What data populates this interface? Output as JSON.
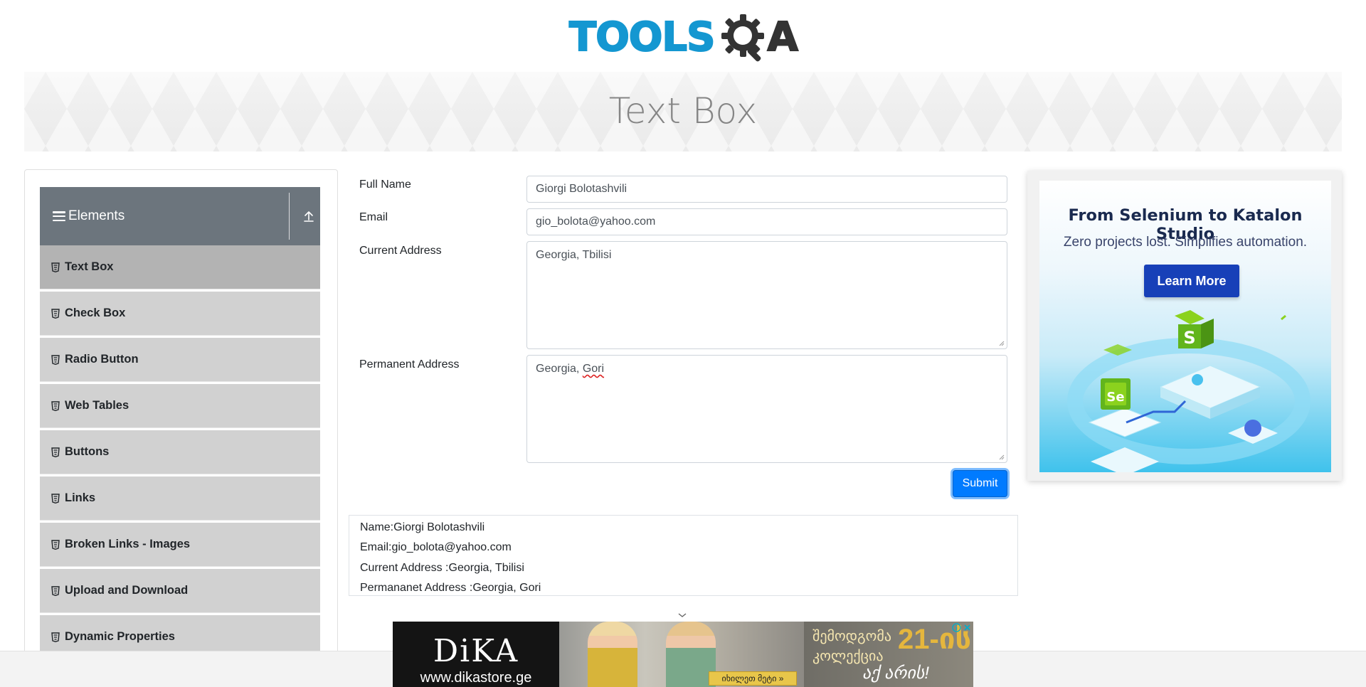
{
  "logo": {
    "text_left": "TOOLS",
    "text_right": "A"
  },
  "banner": {
    "title": "Text Box"
  },
  "sidebar": {
    "group_title": "Elements",
    "items": [
      {
        "label": "Text Box",
        "active": true
      },
      {
        "label": "Check Box"
      },
      {
        "label": "Radio Button"
      },
      {
        "label": "Web Tables"
      },
      {
        "label": "Buttons"
      },
      {
        "label": "Links"
      },
      {
        "label": "Broken Links - Images"
      },
      {
        "label": "Upload and Download"
      },
      {
        "label": "Dynamic Properties"
      }
    ]
  },
  "form": {
    "full_name": {
      "label": "Full Name",
      "value": "Giorgi Bolotashvili"
    },
    "email": {
      "label": "Email",
      "value": "gio_bolota@yahoo.com"
    },
    "current_address": {
      "label": "Current Address",
      "value": "Georgia, Tbilisi"
    },
    "permanent_address": {
      "label": "Permanent Address",
      "value_prefix": "Georgia, ",
      "value_misspelled": "Gori"
    },
    "submit_label": "Submit"
  },
  "output": {
    "name": "Name:Giorgi Bolotashvili",
    "email": "Email:gio_bolota@yahoo.com",
    "current_address": "Current Address :Georgia, Tbilisi",
    "permanent_address": "Permananet Address :Georgia, Gori"
  },
  "side_ad": {
    "title": "From Selenium to Katalon Studio",
    "subtitle": "Zero projects lost. Simplifies automation.",
    "button": "Learn More"
  },
  "bottom_ad": {
    "brand": "DiKA",
    "site": "www.dikastore.ge",
    "georgian_line1": "შემოდგომა",
    "georgian_number": "21-ის",
    "georgian_line2": "კოლექცია",
    "georgian_line3": "აქ არის!",
    "button": "იხილეთ მეტი »"
  },
  "colors": {
    "accent": "#007bff",
    "sidebar_header": "#6c757d",
    "menu_item": "#d1d1d1",
    "menu_item_active": "#b3b3b3",
    "logo_blue": "#1497d1"
  },
  "icons": {
    "menu": "hamburger-icon",
    "collapse": "collapse-arrow-icon",
    "menu_item": "html5-icon",
    "resize": "resize-grip-icon"
  }
}
